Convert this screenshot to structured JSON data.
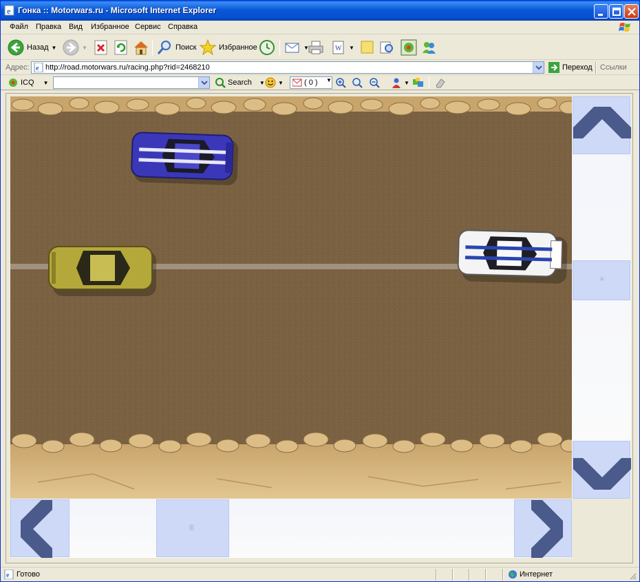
{
  "window": {
    "title": "Гонка :: Motorwars.ru - Microsoft Internet Explorer"
  },
  "menu": {
    "items": [
      "Файл",
      "Правка",
      "Вид",
      "Избранное",
      "Сервис",
      "Справка"
    ]
  },
  "toolbar": {
    "back_label": "Назад",
    "search_label": "Поиск",
    "favorites_label": "Избранное"
  },
  "address": {
    "label": "Адрес:",
    "url": "http://road.motorwars.ru/racing.php?rid=2468210",
    "go_label": "Переход",
    "links_label": "Ссылки"
  },
  "icq": {
    "label": "ICQ",
    "search_value": "",
    "search_button_label": "Search",
    "mail_count": "( 0 )"
  },
  "status": {
    "text": "Готово",
    "zone": "Интернет"
  },
  "race": {
    "cars": [
      {
        "name": "blue",
        "color": "#3a38b8",
        "stripe": "#e8e8f8"
      },
      {
        "name": "yellow",
        "color": "#b5a83a",
        "stripe": "#c8bd52"
      },
      {
        "name": "white",
        "color": "#f4f4f4",
        "stripe": "#2a45b0"
      }
    ],
    "controls": {
      "up": "up-arrow",
      "down": "down-arrow",
      "left": "left-arrow",
      "right": "right-arrow"
    }
  },
  "colors": {
    "titlebar": "#0a59d8",
    "control_button": "#ced9f8",
    "arrow": "#4a5a8a",
    "track": "#7a6142",
    "sand": "#d8b882"
  }
}
